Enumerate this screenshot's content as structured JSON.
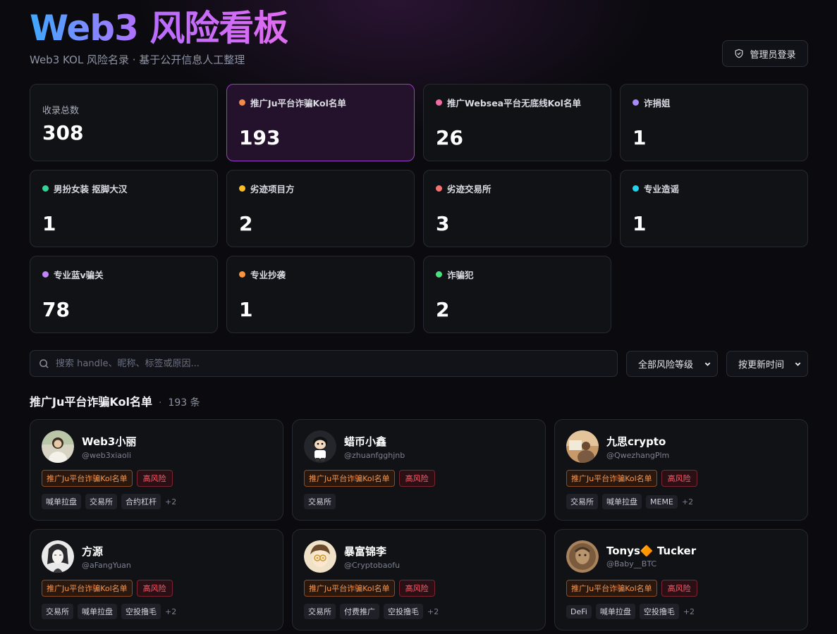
{
  "header": {
    "title": "Web3 风险看板",
    "subtitle": "Web3 KOL 风险名录 · 基于公开信息人工整理",
    "admin_label": "管理员登录"
  },
  "stats": [
    {
      "label": "收录总数",
      "value": "308",
      "total": true
    },
    {
      "label": "推广Ju平台诈骗Kol名单",
      "value": "193",
      "color": "#f28a4a",
      "active": true
    },
    {
      "label": "推广Websea平台无底线Kol名单",
      "value": "26",
      "color": "#f26aa6"
    },
    {
      "label": "诈捐姐",
      "value": "1",
      "color": "#a78bfa"
    },
    {
      "label": "男扮女装 抠脚大汉",
      "value": "1",
      "color": "#34d399"
    },
    {
      "label": "劣迹项目方",
      "value": "2",
      "color": "#fbbf24"
    },
    {
      "label": "劣迹交易所",
      "value": "3",
      "color": "#f87171"
    },
    {
      "label": "专业造谣",
      "value": "1",
      "color": "#22d3ee"
    },
    {
      "label": "专业蓝v骗关",
      "value": "78",
      "color": "#c084fc"
    },
    {
      "label": "专业抄袭",
      "value": "1",
      "color": "#fb923c"
    },
    {
      "label": "诈骗犯",
      "value": "2",
      "color": "#4ade80"
    }
  ],
  "search": {
    "placeholder": "搜索 handle、昵称、标签或原因..."
  },
  "filters": {
    "risk_level": "全部风险等级",
    "sort": "按更新时间"
  },
  "section": {
    "title": "推广Ju平台诈骗Kol名单",
    "count": "193 条"
  },
  "cards": [
    {
      "name": "Web3小丽",
      "handle": "@web3xiaoli",
      "category": "推广Ju平台诈骗Kol名单",
      "risk": "高风险",
      "tags": [
        "喊单拉盘",
        "交易所",
        "合约杠杆"
      ],
      "more": "+2",
      "avatar": "photo-light"
    },
    {
      "name": "蜡币小鑫",
      "handle": "@zhuanfgghjnb",
      "category": "推广Ju平台诈骗Kol名单",
      "risk": "高风险",
      "tags": [
        "交易所"
      ],
      "more": "",
      "avatar": "cartoon-dark"
    },
    {
      "name": "九思crypto",
      "handle": "@QwezhangPlm",
      "category": "推广Ju平台诈骗Kol名单",
      "risk": "高风险",
      "tags": [
        "交易所",
        "喊单拉盘",
        "MEME"
      ],
      "more": "+2",
      "avatar": "photo-warm"
    },
    {
      "name": "方源",
      "handle": "@aFangYuan",
      "category": "推广Ju平台诈骗Kol名单",
      "risk": "高风险",
      "tags": [
        "交易所",
        "喊单拉盘",
        "空投撸毛"
      ],
      "more": "+2",
      "avatar": "sketch"
    },
    {
      "name": "暴富锦李",
      "handle": "@Cryptobaofu",
      "category": "推广Ju平台诈骗Kol名单",
      "risk": "高风险",
      "tags": [
        "交易所",
        "付费推广",
        "空投撸毛"
      ],
      "more": "+2",
      "avatar": "anime"
    },
    {
      "name": "Tonys🔶 Tucker",
      "handle": "@Baby__BTC",
      "category": "推广Ju平台诈骗Kol名单",
      "risk": "高风险",
      "tags": [
        "DeFi",
        "喊单拉盘",
        "空投撸毛"
      ],
      "more": "+2",
      "avatar": "sepia"
    }
  ]
}
